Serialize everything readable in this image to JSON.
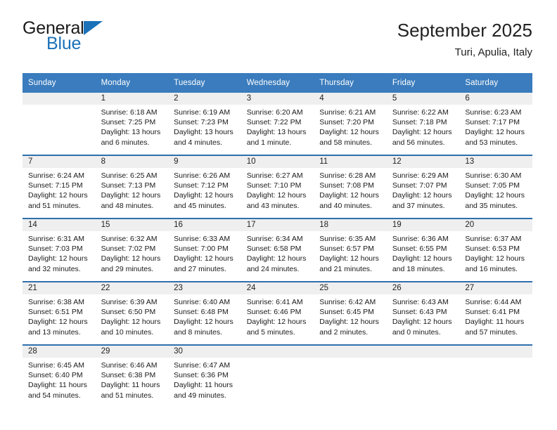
{
  "brand": {
    "name_part1": "General",
    "name_part2": "Blue",
    "mark": "triangle-logo"
  },
  "header": {
    "title": "September 2025",
    "subtitle": "Turi, Apulia, Italy"
  },
  "colors": {
    "header_blue": "#3a7cbd",
    "row_rule_blue": "#2f6fad",
    "daynum_band": "#efefef",
    "brand_blue": "#1b72b8"
  },
  "weekday_headers": [
    "Sunday",
    "Monday",
    "Tuesday",
    "Wednesday",
    "Thursday",
    "Friday",
    "Saturday"
  ],
  "labels": {
    "sunrise_prefix": "Sunrise:",
    "sunset_prefix": "Sunset:",
    "daylight_prefix": "Daylight:"
  },
  "weeks": [
    [
      {
        "day": "",
        "empty": true,
        "sunrise": "",
        "sunset": "",
        "daylight_line1": "",
        "daylight_line2": ""
      },
      {
        "day": "1",
        "sunrise": "Sunrise: 6:18 AM",
        "sunset": "Sunset: 7:25 PM",
        "daylight_line1": "Daylight: 13 hours",
        "daylight_line2": "and 6 minutes."
      },
      {
        "day": "2",
        "sunrise": "Sunrise: 6:19 AM",
        "sunset": "Sunset: 7:23 PM",
        "daylight_line1": "Daylight: 13 hours",
        "daylight_line2": "and 4 minutes."
      },
      {
        "day": "3",
        "sunrise": "Sunrise: 6:20 AM",
        "sunset": "Sunset: 7:22 PM",
        "daylight_line1": "Daylight: 13 hours",
        "daylight_line2": "and 1 minute."
      },
      {
        "day": "4",
        "sunrise": "Sunrise: 6:21 AM",
        "sunset": "Sunset: 7:20 PM",
        "daylight_line1": "Daylight: 12 hours",
        "daylight_line2": "and 58 minutes."
      },
      {
        "day": "5",
        "sunrise": "Sunrise: 6:22 AM",
        "sunset": "Sunset: 7:18 PM",
        "daylight_line1": "Daylight: 12 hours",
        "daylight_line2": "and 56 minutes."
      },
      {
        "day": "6",
        "sunrise": "Sunrise: 6:23 AM",
        "sunset": "Sunset: 7:17 PM",
        "daylight_line1": "Daylight: 12 hours",
        "daylight_line2": "and 53 minutes."
      }
    ],
    [
      {
        "day": "7",
        "sunrise": "Sunrise: 6:24 AM",
        "sunset": "Sunset: 7:15 PM",
        "daylight_line1": "Daylight: 12 hours",
        "daylight_line2": "and 51 minutes."
      },
      {
        "day": "8",
        "sunrise": "Sunrise: 6:25 AM",
        "sunset": "Sunset: 7:13 PM",
        "daylight_line1": "Daylight: 12 hours",
        "daylight_line2": "and 48 minutes."
      },
      {
        "day": "9",
        "sunrise": "Sunrise: 6:26 AM",
        "sunset": "Sunset: 7:12 PM",
        "daylight_line1": "Daylight: 12 hours",
        "daylight_line2": "and 45 minutes."
      },
      {
        "day": "10",
        "sunrise": "Sunrise: 6:27 AM",
        "sunset": "Sunset: 7:10 PM",
        "daylight_line1": "Daylight: 12 hours",
        "daylight_line2": "and 43 minutes."
      },
      {
        "day": "11",
        "sunrise": "Sunrise: 6:28 AM",
        "sunset": "Sunset: 7:08 PM",
        "daylight_line1": "Daylight: 12 hours",
        "daylight_line2": "and 40 minutes."
      },
      {
        "day": "12",
        "sunrise": "Sunrise: 6:29 AM",
        "sunset": "Sunset: 7:07 PM",
        "daylight_line1": "Daylight: 12 hours",
        "daylight_line2": "and 37 minutes."
      },
      {
        "day": "13",
        "sunrise": "Sunrise: 6:30 AM",
        "sunset": "Sunset: 7:05 PM",
        "daylight_line1": "Daylight: 12 hours",
        "daylight_line2": "and 35 minutes."
      }
    ],
    [
      {
        "day": "14",
        "sunrise": "Sunrise: 6:31 AM",
        "sunset": "Sunset: 7:03 PM",
        "daylight_line1": "Daylight: 12 hours",
        "daylight_line2": "and 32 minutes."
      },
      {
        "day": "15",
        "sunrise": "Sunrise: 6:32 AM",
        "sunset": "Sunset: 7:02 PM",
        "daylight_line1": "Daylight: 12 hours",
        "daylight_line2": "and 29 minutes."
      },
      {
        "day": "16",
        "sunrise": "Sunrise: 6:33 AM",
        "sunset": "Sunset: 7:00 PM",
        "daylight_line1": "Daylight: 12 hours",
        "daylight_line2": "and 27 minutes."
      },
      {
        "day": "17",
        "sunrise": "Sunrise: 6:34 AM",
        "sunset": "Sunset: 6:58 PM",
        "daylight_line1": "Daylight: 12 hours",
        "daylight_line2": "and 24 minutes."
      },
      {
        "day": "18",
        "sunrise": "Sunrise: 6:35 AM",
        "sunset": "Sunset: 6:57 PM",
        "daylight_line1": "Daylight: 12 hours",
        "daylight_line2": "and 21 minutes."
      },
      {
        "day": "19",
        "sunrise": "Sunrise: 6:36 AM",
        "sunset": "Sunset: 6:55 PM",
        "daylight_line1": "Daylight: 12 hours",
        "daylight_line2": "and 18 minutes."
      },
      {
        "day": "20",
        "sunrise": "Sunrise: 6:37 AM",
        "sunset": "Sunset: 6:53 PM",
        "daylight_line1": "Daylight: 12 hours",
        "daylight_line2": "and 16 minutes."
      }
    ],
    [
      {
        "day": "21",
        "sunrise": "Sunrise: 6:38 AM",
        "sunset": "Sunset: 6:51 PM",
        "daylight_line1": "Daylight: 12 hours",
        "daylight_line2": "and 13 minutes."
      },
      {
        "day": "22",
        "sunrise": "Sunrise: 6:39 AM",
        "sunset": "Sunset: 6:50 PM",
        "daylight_line1": "Daylight: 12 hours",
        "daylight_line2": "and 10 minutes."
      },
      {
        "day": "23",
        "sunrise": "Sunrise: 6:40 AM",
        "sunset": "Sunset: 6:48 PM",
        "daylight_line1": "Daylight: 12 hours",
        "daylight_line2": "and 8 minutes."
      },
      {
        "day": "24",
        "sunrise": "Sunrise: 6:41 AM",
        "sunset": "Sunset: 6:46 PM",
        "daylight_line1": "Daylight: 12 hours",
        "daylight_line2": "and 5 minutes."
      },
      {
        "day": "25",
        "sunrise": "Sunrise: 6:42 AM",
        "sunset": "Sunset: 6:45 PM",
        "daylight_line1": "Daylight: 12 hours",
        "daylight_line2": "and 2 minutes."
      },
      {
        "day": "26",
        "sunrise": "Sunrise: 6:43 AM",
        "sunset": "Sunset: 6:43 PM",
        "daylight_line1": "Daylight: 12 hours",
        "daylight_line2": "and 0 minutes."
      },
      {
        "day": "27",
        "sunrise": "Sunrise: 6:44 AM",
        "sunset": "Sunset: 6:41 PM",
        "daylight_line1": "Daylight: 11 hours",
        "daylight_line2": "and 57 minutes."
      }
    ],
    [
      {
        "day": "28",
        "sunrise": "Sunrise: 6:45 AM",
        "sunset": "Sunset: 6:40 PM",
        "daylight_line1": "Daylight: 11 hours",
        "daylight_line2": "and 54 minutes."
      },
      {
        "day": "29",
        "sunrise": "Sunrise: 6:46 AM",
        "sunset": "Sunset: 6:38 PM",
        "daylight_line1": "Daylight: 11 hours",
        "daylight_line2": "and 51 minutes."
      },
      {
        "day": "30",
        "sunrise": "Sunrise: 6:47 AM",
        "sunset": "Sunset: 6:36 PM",
        "daylight_line1": "Daylight: 11 hours",
        "daylight_line2": "and 49 minutes."
      },
      {
        "day": "",
        "empty": true,
        "sunrise": "",
        "sunset": "",
        "daylight_line1": "",
        "daylight_line2": ""
      },
      {
        "day": "",
        "empty": true,
        "sunrise": "",
        "sunset": "",
        "daylight_line1": "",
        "daylight_line2": ""
      },
      {
        "day": "",
        "empty": true,
        "sunrise": "",
        "sunset": "",
        "daylight_line1": "",
        "daylight_line2": ""
      },
      {
        "day": "",
        "empty": true,
        "sunrise": "",
        "sunset": "",
        "daylight_line1": "",
        "daylight_line2": ""
      }
    ]
  ]
}
